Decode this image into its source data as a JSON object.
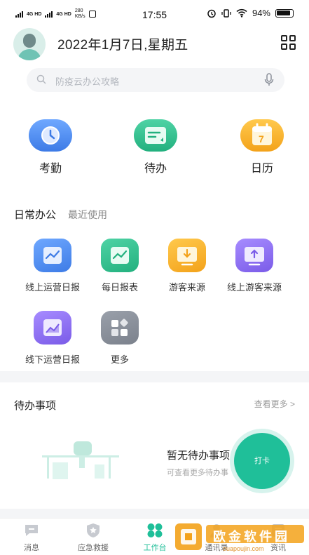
{
  "status_bar": {
    "network1": "4G HD",
    "network2": "4G HD",
    "speed_value": "280",
    "speed_unit": "KB/s",
    "time": "17:55",
    "battery": "94%"
  },
  "header": {
    "date_title": "2022年1月7日,星期五",
    "search_placeholder": "防疫云办公攻略"
  },
  "quick_actions": [
    {
      "label": "考勤",
      "icon": "clock-icon",
      "color": "#4a8df5"
    },
    {
      "label": "待办",
      "icon": "todo-card-icon",
      "color": "#2dbf8c"
    },
    {
      "label": "日历",
      "icon": "calendar-icon",
      "color": "#f7b52b",
      "badge": "7"
    }
  ],
  "daily_office": {
    "title": "日常办公",
    "subtitle": "最近使用",
    "apps": [
      {
        "label": "线上运营日报",
        "icon": "chart-report-icon",
        "color": "#4a8df5"
      },
      {
        "label": "每日报表",
        "icon": "line-chart-icon",
        "color": "#2dbf8c"
      },
      {
        "label": "游客来源",
        "icon": "download-screen-icon",
        "color": "#f7b52b"
      },
      {
        "label": "线上游客来源",
        "icon": "upload-screen-icon",
        "color": "#8b6cf0"
      },
      {
        "label": "线下运营日报",
        "icon": "area-chart-icon",
        "color": "#8b6cf0"
      },
      {
        "label": "更多",
        "icon": "more-apps-icon",
        "color": "#8a8f99"
      }
    ]
  },
  "todo": {
    "title": "待办事项",
    "more": "查看更多 >",
    "empty_title": "暂无待办事项",
    "empty_sub": "可查看更多待办事",
    "punch_label": "打卡"
  },
  "tabbar": {
    "tabs": [
      {
        "label": "消息",
        "icon": "message-icon"
      },
      {
        "label": "应急救援",
        "icon": "shield-star-icon"
      },
      {
        "label": "工作台",
        "icon": "workbench-icon",
        "active": true
      },
      {
        "label": "通讯录",
        "icon": "contacts-icon"
      },
      {
        "label": "资讯",
        "icon": "news-icon"
      }
    ]
  },
  "watermark": {
    "text": "欧金软件园",
    "sub": "ouapoujin.com"
  },
  "colors": {
    "accent": "#1fbf99",
    "background": "#f4f5f7"
  }
}
